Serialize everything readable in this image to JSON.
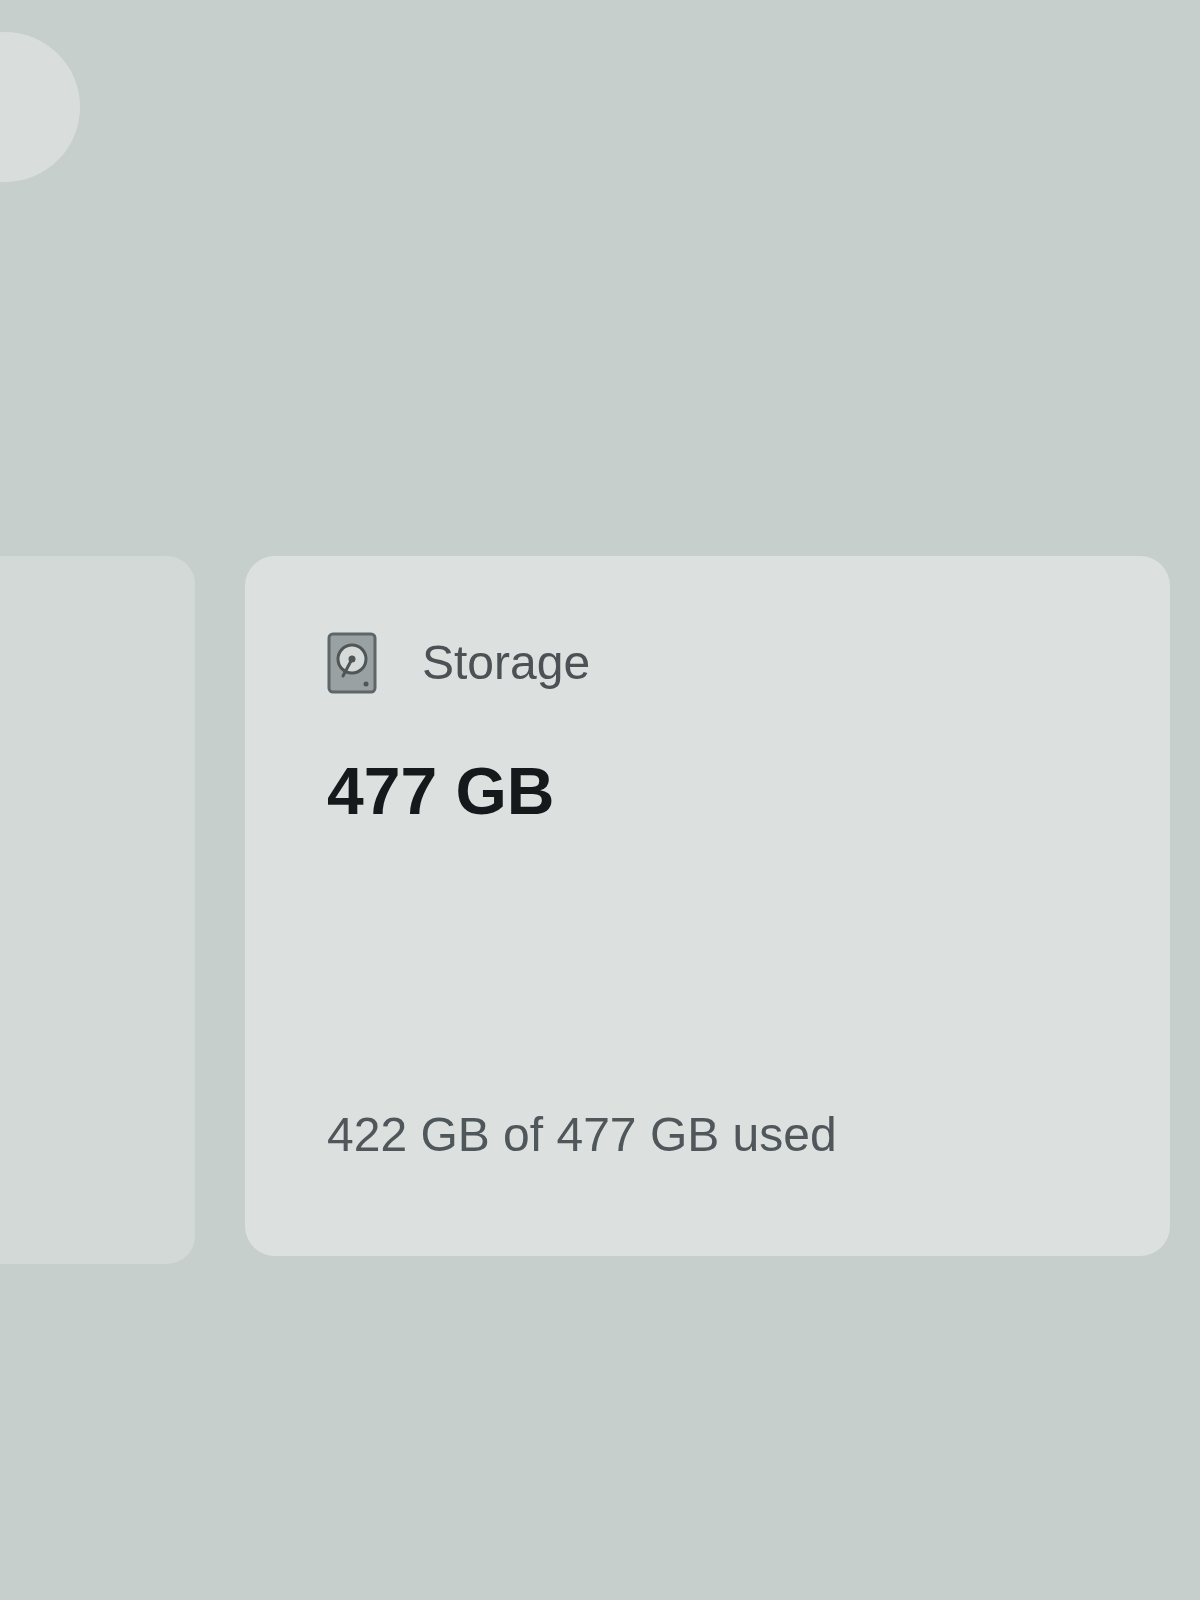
{
  "storage_card": {
    "title": "Storage",
    "total": "477 GB",
    "usage": "422 GB of 477 GB used"
  }
}
